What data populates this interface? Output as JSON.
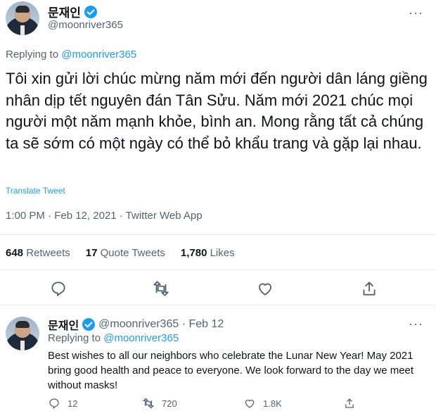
{
  "main_tweet": {
    "author_name": "문재인",
    "handle": "@moonriver365",
    "replying_prefix": "Replying to ",
    "replying_to": "@moonriver365",
    "text": "Tôi xin gửi lời chúc mừng năm mới đến người dân láng giềng nhân dịp tết nguyên đán Tân Sửu. Năm mới 2021 chúc mọi người một năm mạnh khỏe, bình an. Mong rằng tất cả chúng ta sẽ sớm có một ngày có thể bỏ khẩu trang và gặp lại nhau.",
    "translate_label": "Translate Tweet",
    "timestamp": "1:00 PM · Feb 12, 2021 · Twitter Web App",
    "stats": {
      "retweets_count": "648",
      "retweets_label": "Retweets",
      "quotes_count": "17",
      "quotes_label": "Quote Tweets",
      "likes_count": "1,780",
      "likes_label": "Likes"
    },
    "more_glyph": "···"
  },
  "reply_tweet": {
    "author_name": "문재인",
    "handle_time": "@moonriver365 · Feb 12",
    "replying_prefix": "Replying to ",
    "replying_to": "@moonriver365",
    "text": "Best wishes to all our neighbors who celebrate the Lunar New Year! May 2021 bring good health and peace to everyone. We look forward to the day we meet without masks!",
    "reply_count": "12",
    "retweet_count": "720",
    "like_count": "1.8K",
    "more_glyph": "···"
  },
  "colors": {
    "accent": "#1d9bf0",
    "secondary_text": "#536471",
    "border": "#e6ecf0"
  },
  "icons": [
    "verified-badge-icon",
    "reply-icon",
    "retweet-icon",
    "like-icon",
    "share-icon",
    "more-icon"
  ]
}
